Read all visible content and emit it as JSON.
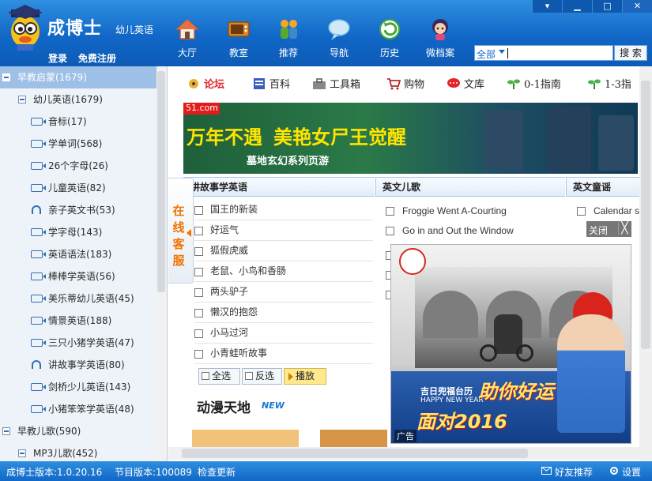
{
  "app": {
    "name": "成博士",
    "subtitle": "幼儿英语",
    "login": "登录",
    "register": "免费注册"
  },
  "window_controls": [
    "▾",
    "▁",
    "□",
    "✕"
  ],
  "nav": [
    {
      "label": "大厅",
      "icon": "house-icon",
      "color": "#e8703a"
    },
    {
      "label": "教室",
      "icon": "tv-icon",
      "color": "#d6882b"
    },
    {
      "label": "推荐",
      "icon": "people-icon",
      "color": "#f5a623"
    },
    {
      "label": "导航",
      "icon": "speech-bubble-icon",
      "color": "#8fd0f4"
    },
    {
      "label": "历史",
      "icon": "refresh-icon",
      "color": "#43a83b"
    },
    {
      "label": "微档案",
      "icon": "girl-avatar-icon",
      "color": "#6b4f99"
    }
  ],
  "search": {
    "scope": "全部",
    "value": "",
    "button": "搜 索"
  },
  "sidebar": {
    "items": [
      {
        "label": "早教启蒙(1679)",
        "level": 0,
        "icon": "collapse",
        "selected": true
      },
      {
        "label": "幼儿英语(1679)",
        "level": 1,
        "icon": "collapse"
      },
      {
        "label": "音标(17)",
        "level": 2,
        "icon": "video"
      },
      {
        "label": "学单词(568)",
        "level": 2,
        "icon": "video"
      },
      {
        "label": "26个字母(26)",
        "level": 2,
        "icon": "video"
      },
      {
        "label": "儿童英语(82)",
        "level": 2,
        "icon": "video"
      },
      {
        "label": "亲子英文书(53)",
        "level": 2,
        "icon": "audio"
      },
      {
        "label": "学字母(143)",
        "level": 2,
        "icon": "video"
      },
      {
        "label": "英语语法(183)",
        "level": 2,
        "icon": "video"
      },
      {
        "label": "棒棒学英语(56)",
        "level": 2,
        "icon": "video"
      },
      {
        "label": "美乐蒂幼儿英语(45)",
        "level": 2,
        "icon": "video"
      },
      {
        "label": "情景英语(188)",
        "level": 2,
        "icon": "video"
      },
      {
        "label": "三只小猪学英语(47)",
        "level": 2,
        "icon": "video"
      },
      {
        "label": "讲故事学英语(80)",
        "level": 2,
        "icon": "audio"
      },
      {
        "label": "剑桥少儿英语(143)",
        "level": 2,
        "icon": "video"
      },
      {
        "label": "小猪笨笨学英语(48)",
        "level": 2,
        "icon": "video"
      },
      {
        "label": "早教儿歌(590)",
        "level": 0,
        "icon": "collapse"
      },
      {
        "label": "MP3儿歌(452)",
        "level": 1,
        "icon": "collapse"
      }
    ]
  },
  "topnav": [
    {
      "label": "论坛",
      "icon": "forum-icon",
      "color": "#e0262a",
      "highlight": true
    },
    {
      "label": "百科",
      "icon": "book-icon",
      "color": "#3a5fbf"
    },
    {
      "label": "工具箱",
      "icon": "toolbox-icon",
      "color": "#666666"
    },
    {
      "label": "购物",
      "icon": "cart-icon",
      "color": "#b02c2c"
    },
    {
      "label": "文库",
      "icon": "chat-icon",
      "color": "#e0262a"
    },
    {
      "label": "0-1指南",
      "icon": "sprout-icon",
      "color": "#4caf50"
    },
    {
      "label": "1-3指",
      "icon": "sprout-icon",
      "color": "#4caf50"
    }
  ],
  "banner": {
    "tag": "51.com",
    "line1": "万年不遇",
    "line2": "美艳女尸王觉醒",
    "line3": "墓地玄幻系列页游"
  },
  "online_service": "在线客服",
  "columns": [
    {
      "title": "讲故事学英语"
    },
    {
      "title": "英文儿歌"
    },
    {
      "title": "英文童谣"
    }
  ],
  "stories": [
    "国王的新装",
    "好运气",
    "狐假虎威",
    "老鼠、小鸟和香肠",
    "两头驴子",
    "懒汉的抱怨",
    "小马过河",
    "小青蛙听故事"
  ],
  "songs": [
    "Froggie Went A-Courting",
    "Go in and Out the Window"
  ],
  "rhymes": [
    "Calendar s"
  ],
  "list_buttons": {
    "select_all": "全选",
    "invert": "反选",
    "play": "播放"
  },
  "anime_title": "动漫天地",
  "anime_badge": "NEW",
  "popup": {
    "close_label": "关闭",
    "close_x": "╳",
    "ad_tag": "广告",
    "headline": "助你好运",
    "year_line": "面对2016",
    "greeting": "HAPPY NEW YEAR",
    "brand": "吉日兜福台历"
  },
  "status": {
    "client_version": "成博士版本:1.0.20.16",
    "program_version": "节目版本:100089",
    "check_update": "检查更新",
    "recommend": "好友推荐",
    "settings": "设置"
  }
}
